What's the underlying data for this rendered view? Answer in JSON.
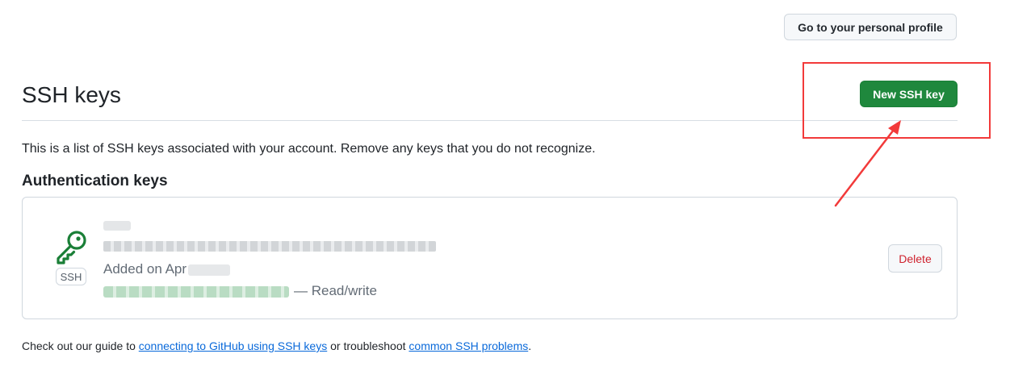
{
  "header": {
    "profile_button": "Go to your personal profile"
  },
  "page": {
    "title": "SSH keys",
    "new_key_button": "New SSH key",
    "description": "This is a list of SSH keys associated with your account. Remove any keys that you do not recognize."
  },
  "authentication": {
    "heading": "Authentication keys",
    "keys": [
      {
        "type_badge": "SSH",
        "added_prefix": "Added on Apr",
        "access": "— Read/write",
        "icon": "key-icon"
      }
    ],
    "delete_button": "Delete"
  },
  "footer": {
    "prefix": "Check out our guide to ",
    "link1": "connecting to GitHub using SSH keys",
    "middle": " or troubleshoot ",
    "link2": "common SSH problems",
    "suffix": "."
  },
  "colors": {
    "primary_green": "#1f883d",
    "danger_red": "#cf222e",
    "link_blue": "#0969da",
    "annotation_red": "#f23a3a"
  }
}
